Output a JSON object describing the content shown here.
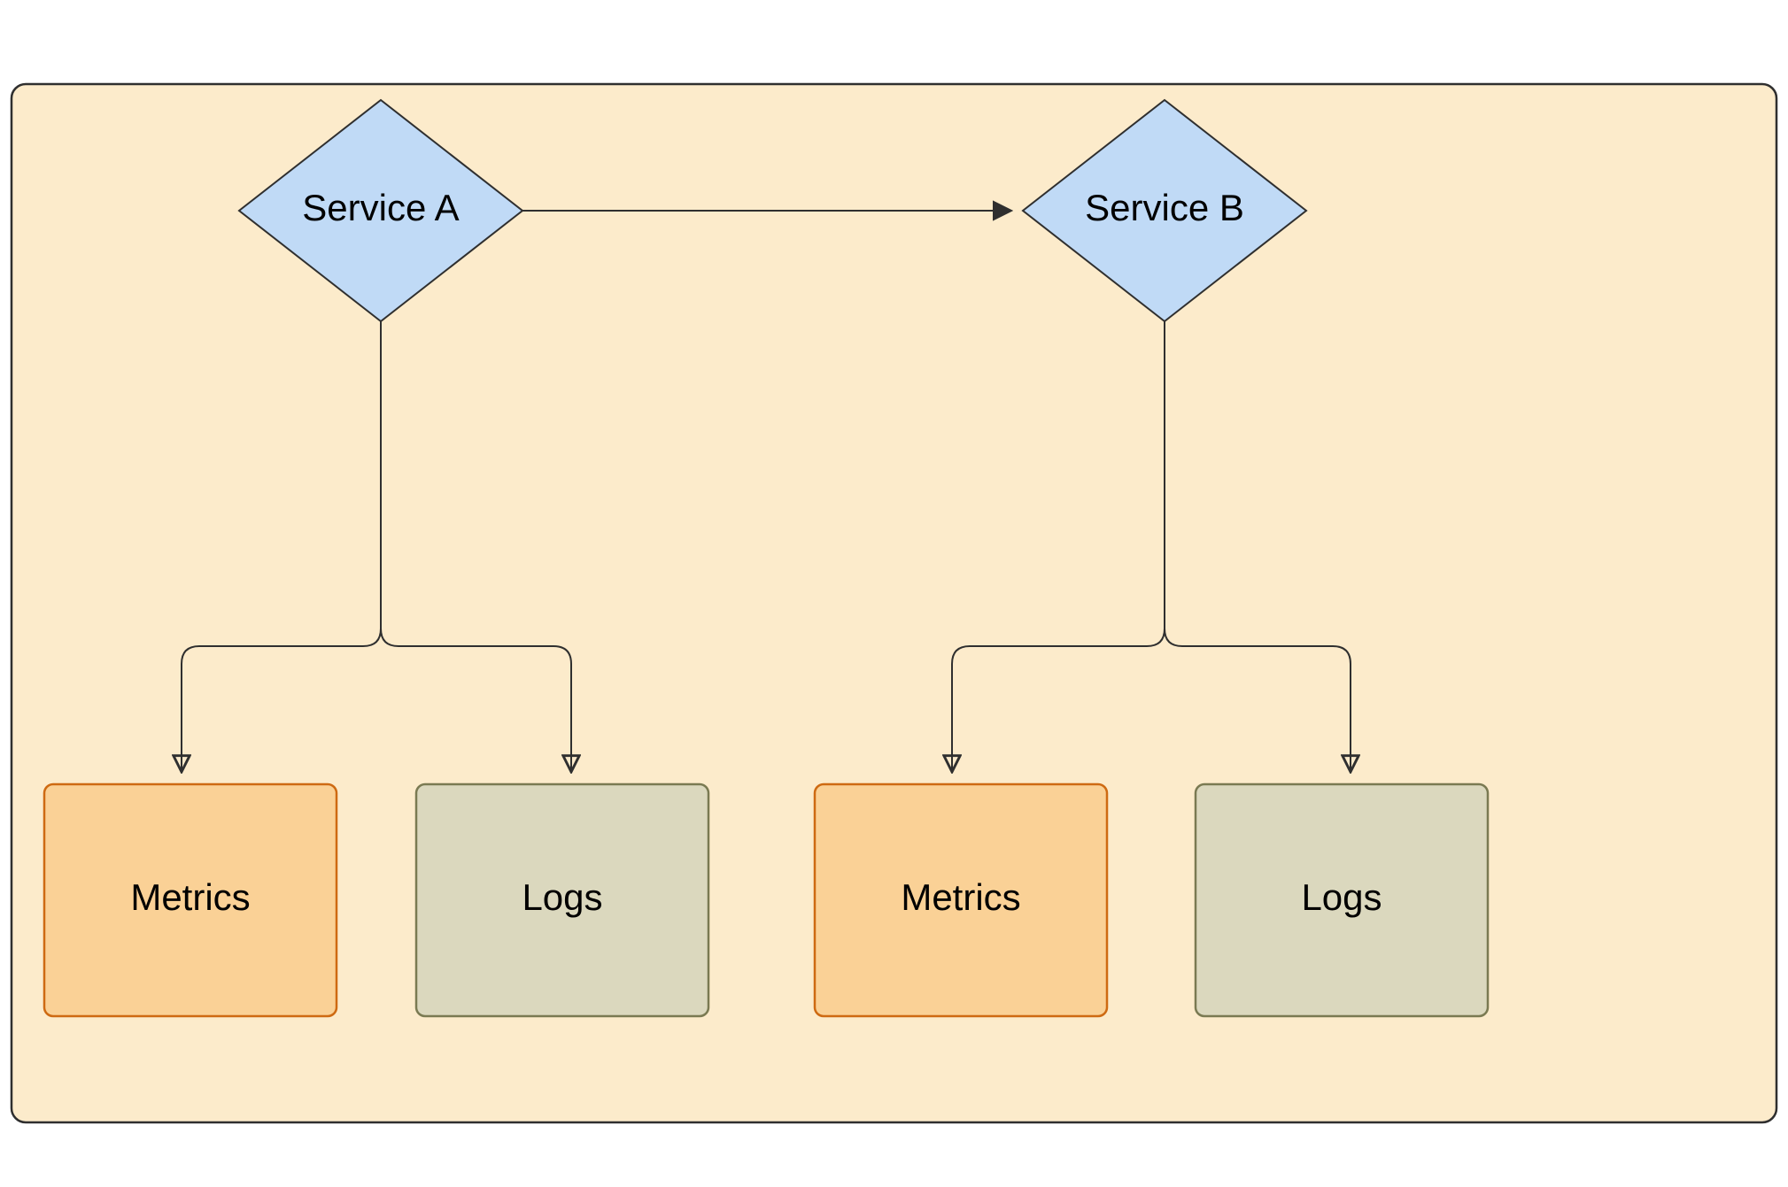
{
  "diagram": {
    "container": {
      "fill": "#FCEBCB",
      "stroke": "#2F2F2F",
      "radius": 16
    },
    "nodes": {
      "serviceA": {
        "label": "Service A",
        "fill": "#C0DAF6",
        "stroke": "#2F2F2F"
      },
      "serviceB": {
        "label": "Service B",
        "fill": "#C0DAF6",
        "stroke": "#2F2F2F"
      },
      "metricsA": {
        "label": "Metrics",
        "fill": "#FAD196",
        "stroke": "#CE6A12"
      },
      "logsA": {
        "label": "Logs",
        "fill": "#DBD8BE",
        "stroke": "#7A7A52"
      },
      "metricsB": {
        "label": "Metrics",
        "fill": "#FAD196",
        "stroke": "#CE6A12"
      },
      "logsB": {
        "label": "Logs",
        "fill": "#DBD8BE",
        "stroke": "#7A7A52"
      }
    },
    "edges": [
      {
        "from": "serviceA",
        "to": "serviceB"
      },
      {
        "from": "serviceA",
        "to": "metricsA"
      },
      {
        "from": "serviceA",
        "to": "logsA"
      },
      {
        "from": "serviceB",
        "to": "metricsB"
      },
      {
        "from": "serviceB",
        "to": "logsB"
      }
    ]
  }
}
